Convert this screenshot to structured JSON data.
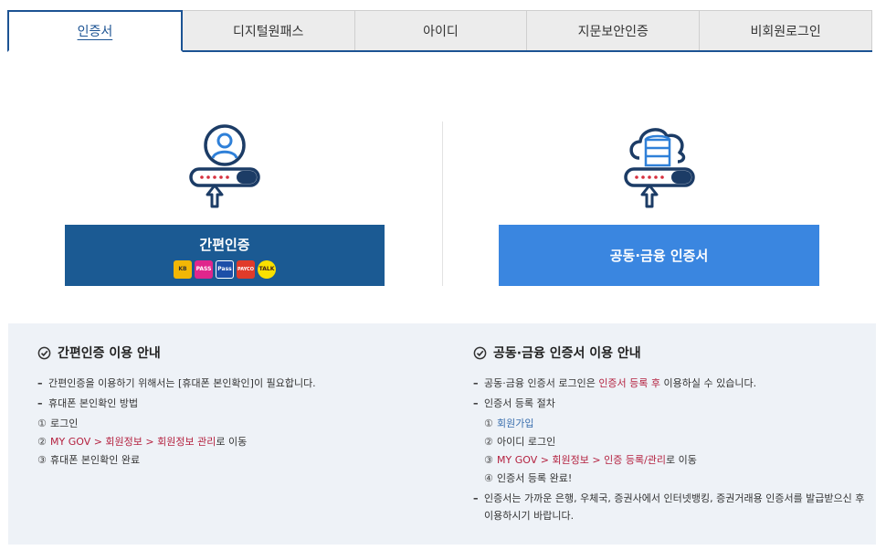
{
  "tabs": [
    {
      "label": "인증서",
      "active": true
    },
    {
      "label": "디지털원패스",
      "active": false
    },
    {
      "label": "아이디",
      "active": false
    },
    {
      "label": "지문보안인증",
      "active": false
    },
    {
      "label": "비회원로그인",
      "active": false
    }
  ],
  "options": {
    "simple_auth_label": "간편인증",
    "simple_auth_apps": [
      {
        "name": "kb",
        "color": "#f2b705",
        "text": "KB"
      },
      {
        "name": "pass",
        "color": "#e0268c",
        "text": "PASS"
      },
      {
        "name": "samsung-pass",
        "color": "#1d4fa8",
        "text": "Pass"
      },
      {
        "name": "payco",
        "color": "#e03b2a",
        "text": "PAYCO"
      },
      {
        "name": "kakao",
        "color": "#f9e000",
        "text": "TALK"
      }
    ],
    "cert_label": "공동·금융 인증서"
  },
  "guide_simple": {
    "title": "간편인증 이용 안내",
    "line1": "간편인증을 이용하기 위해서는 [휴대폰 본인확인]이 필요합니다.",
    "line2": "휴대폰 본인확인 방법",
    "step1_num": "①",
    "step1": "로그인",
    "step2_num": "②",
    "step2_red": "MY GOV > 회원정보 > 회원정보 관리",
    "step2_rest": "로 이동",
    "step3_num": "③",
    "step3": "휴대폰 본인확인 완료"
  },
  "guide_cert": {
    "title": "공동·금융 인증서 이용 안내",
    "line1_a": "공동·금융 인증서 로그인은 ",
    "line1_red": "인증서 등록 후",
    "line1_b": " 이용하실 수 있습니다.",
    "line2": "인증서 등록 절차",
    "step1_num": "①",
    "step1_blue": "회원가입",
    "step2_num": "②",
    "step2": "아이디 로그인",
    "step3_num": "③",
    "step3_red": "MY GOV > 회원정보 > 인증 등록/관리",
    "step3_rest": "로 이동",
    "step4_num": "④",
    "step4": "인증서 등록 완료!",
    "line3": "인증서는 가까운 은행, 우체국, 증권사에서 인터넷뱅킹, 증권거래용 인증서를 발급받으신 후 이용하시기 바랍니다."
  },
  "colors": {
    "primary": "#1b5a93",
    "cert_button": "#3a86e0",
    "accent_red": "#b4213f"
  }
}
